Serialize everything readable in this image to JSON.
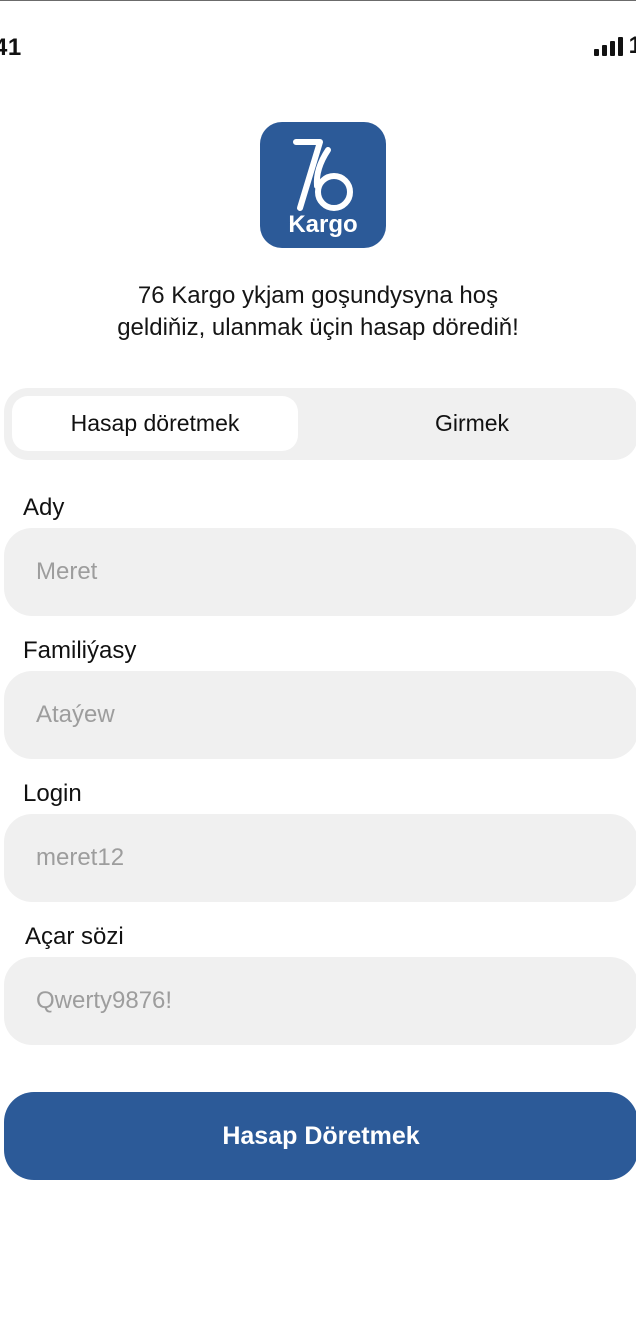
{
  "status_bar": {
    "time": "41",
    "battery": "1"
  },
  "logo": {
    "number": "76",
    "word": "Kargo",
    "color": "#2c5a98"
  },
  "welcome": {
    "line1": "76 Kargo ykjam goşundysyna hoş",
    "line2": "geldiňiz, ulanmak üçin hasap dörediň!"
  },
  "tabs": {
    "active": "Hasap döretmek",
    "inactive": "Girmek"
  },
  "form": {
    "first_name": {
      "label": "Ady",
      "placeholder": "Meret"
    },
    "last_name": {
      "label": "Familiýasy",
      "placeholder": "Ataýew"
    },
    "login": {
      "label": "Login",
      "placeholder": "meret12"
    },
    "password": {
      "label": "Açar sözi",
      "placeholder": "Qwerty9876!"
    }
  },
  "submit": {
    "label": "Hasap Döretmek"
  },
  "colors": {
    "primary": "#2c5a98",
    "field_bg": "#f0f0f0",
    "placeholder": "#9d9d9d"
  }
}
